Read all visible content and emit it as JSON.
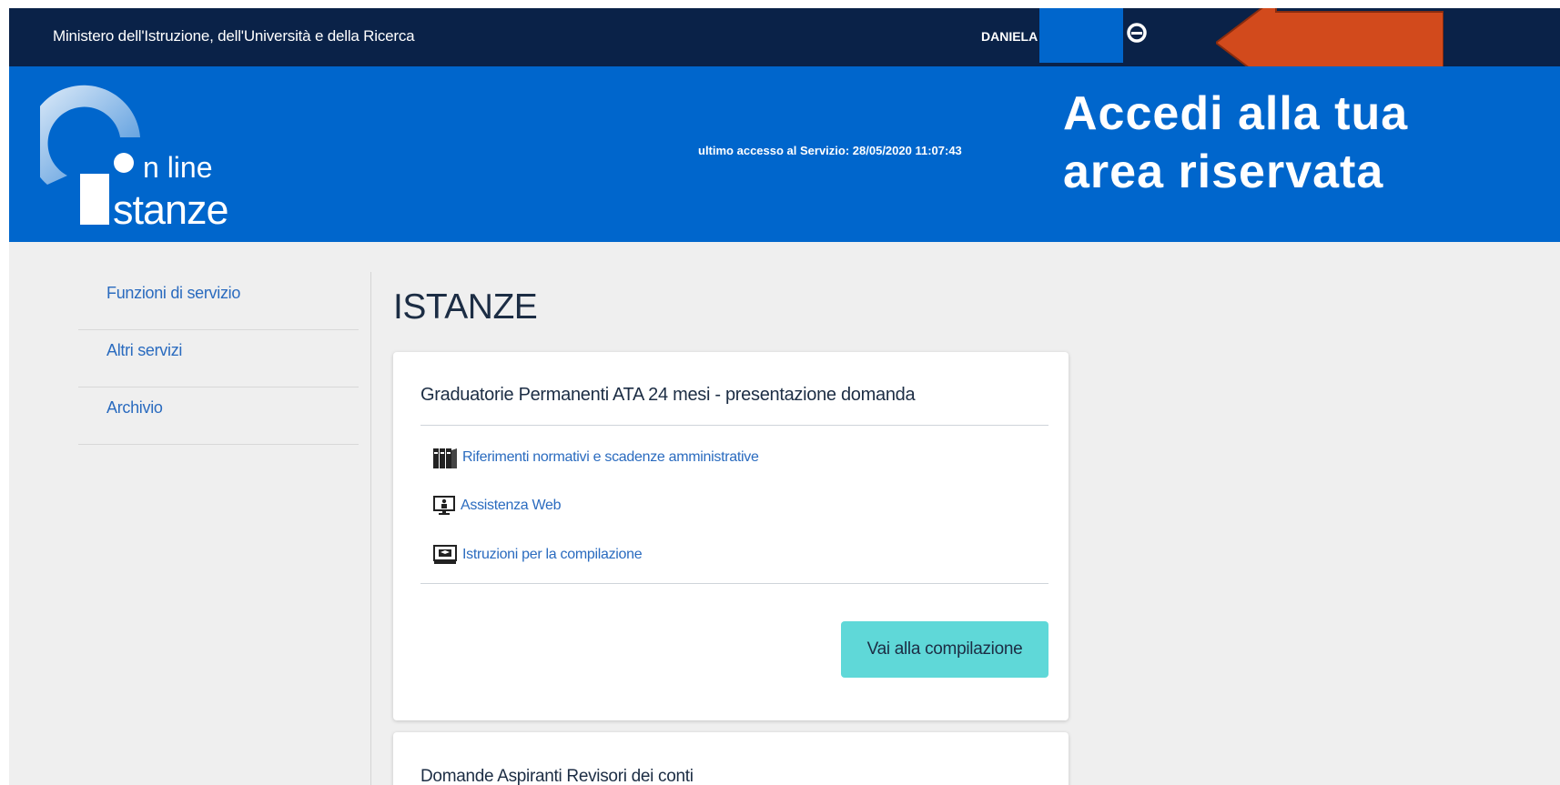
{
  "header": {
    "ministry": "Ministero dell'Istruzione, dell'Università e della Ricerca",
    "user_name": "DANIELA"
  },
  "hero": {
    "logo_line1": "n line",
    "logo_line2": "stanze",
    "last_access": "ultimo accesso al Servizio: 28/05/2020 11:07:43",
    "callout_line1": "Accedi alla tua",
    "callout_line2": "area riservata"
  },
  "sidebar": {
    "items": [
      {
        "label": "Funzioni di servizio"
      },
      {
        "label": "Altri servizi"
      },
      {
        "label": "Archivio"
      }
    ]
  },
  "main": {
    "title": "ISTANZE",
    "cards": [
      {
        "title": "Graduatorie Permanenti ATA 24 mesi - presentazione domanda",
        "links": [
          {
            "label": "Riferimenti normativi e scadenze amministrative",
            "icon": "binders-icon"
          },
          {
            "label": "Assistenza Web",
            "icon": "support-monitor-icon"
          },
          {
            "label": "Istruzioni per la compilazione",
            "icon": "instructions-monitor-icon"
          }
        ],
        "button": "Vai alla compilazione"
      },
      {
        "title": "Domande Aspiranti Revisori dei conti"
      }
    ]
  },
  "colors": {
    "topbar": "#0a2248",
    "brand_blue": "#0066cc",
    "button": "#5fd8d8",
    "arrow": "#d24a1c",
    "link": "#2a6bbf"
  }
}
